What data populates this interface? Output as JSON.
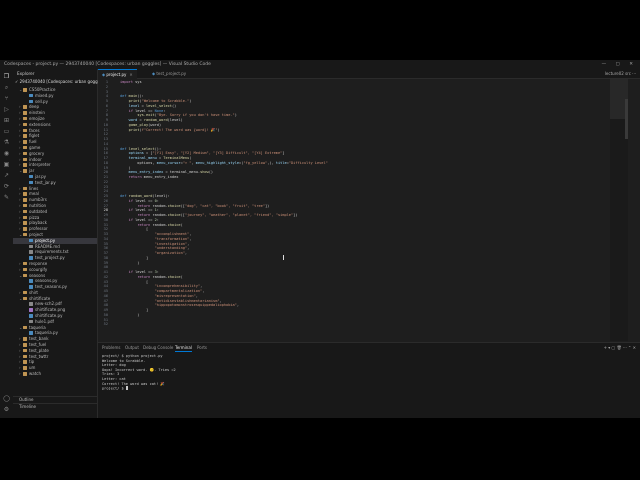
{
  "window": {
    "title": "Codespaces - project.py — 2943740040 [Codespaces: urban goggles] — Visual Studio Code",
    "center_title": "— 2943740040 [Codespaces: urban goggles] — Visual Studio Code",
    "controls": "— ▢ ✕"
  },
  "sidebar": {
    "title": "Explorer",
    "root": "✓ 2943740040 [Codespaces: urban goggles]",
    "items": [
      {
        "label": "CS50Practice",
        "type": "folder",
        "open": true,
        "depth": 1
      },
      {
        "label": "mixed.py",
        "type": "py",
        "depth": 2
      },
      {
        "label": "sell.py",
        "type": "py",
        "depth": 2
      },
      {
        "label": "deep",
        "type": "folder",
        "depth": 1
      },
      {
        "label": "einstein",
        "type": "folder",
        "depth": 1
      },
      {
        "label": "emojize",
        "type": "folder",
        "depth": 1
      },
      {
        "label": "extensions",
        "type": "folder",
        "depth": 1
      },
      {
        "label": "faces",
        "type": "folder",
        "depth": 1
      },
      {
        "label": "figlet",
        "type": "folder",
        "depth": 1
      },
      {
        "label": "fuel",
        "type": "folder",
        "depth": 1
      },
      {
        "label": "game",
        "type": "folder",
        "depth": 1
      },
      {
        "label": "grocery",
        "type": "folder",
        "depth": 1
      },
      {
        "label": "indoor",
        "type": "folder",
        "depth": 1
      },
      {
        "label": "interpreter",
        "type": "folder",
        "depth": 1
      },
      {
        "label": "jar",
        "type": "folder",
        "open": true,
        "depth": 1
      },
      {
        "label": "jar.py",
        "type": "py",
        "depth": 2
      },
      {
        "label": "test_jar.py",
        "type": "py",
        "depth": 2
      },
      {
        "label": "lines",
        "type": "folder",
        "depth": 1
      },
      {
        "label": "meal",
        "type": "folder",
        "depth": 1
      },
      {
        "label": "numb3rs",
        "type": "folder",
        "depth": 1
      },
      {
        "label": "nutrition",
        "type": "folder",
        "depth": 1
      },
      {
        "label": "outdated",
        "type": "folder",
        "depth": 1
      },
      {
        "label": "pizza",
        "type": "folder",
        "depth": 1
      },
      {
        "label": "playback",
        "type": "folder",
        "depth": 1
      },
      {
        "label": "professor",
        "type": "folder",
        "depth": 1
      },
      {
        "label": "project",
        "type": "folder",
        "open": true,
        "depth": 1
      },
      {
        "label": "project.py",
        "type": "py",
        "depth": 2,
        "current": true
      },
      {
        "label": "README.md",
        "type": "txt",
        "depth": 2
      },
      {
        "label": "requirements.txt",
        "type": "txt",
        "depth": 2
      },
      {
        "label": "test_project.py",
        "type": "py",
        "depth": 2
      },
      {
        "label": "response",
        "type": "folder",
        "depth": 1
      },
      {
        "label": "scourgify",
        "type": "folder",
        "depth": 1
      },
      {
        "label": "seasons",
        "type": "folder",
        "open": true,
        "depth": 1
      },
      {
        "label": "seasons.py",
        "type": "py",
        "depth": 2
      },
      {
        "label": "test_seasons.py",
        "type": "py",
        "depth": 2
      },
      {
        "label": "shirt",
        "type": "folder",
        "depth": 1
      },
      {
        "label": "shirtificate",
        "type": "folder",
        "open": true,
        "depth": 1
      },
      {
        "label": "new-sch2.pdf",
        "type": "txt",
        "depth": 2
      },
      {
        "label": "shirtificate.png",
        "type": "img",
        "depth": 2
      },
      {
        "label": "shirtificate.py",
        "type": "py",
        "depth": 2
      },
      {
        "label": "hule1.pdf",
        "type": "txt",
        "depth": 2
      },
      {
        "label": "taqueria",
        "type": "folder",
        "open": true,
        "depth": 1
      },
      {
        "label": "taqueria.py",
        "type": "py",
        "depth": 2
      },
      {
        "label": "test_bank",
        "type": "folder",
        "depth": 1
      },
      {
        "label": "test_fuel",
        "type": "folder",
        "depth": 1
      },
      {
        "label": "test_plate",
        "type": "folder",
        "depth": 1
      },
      {
        "label": "test_twttr",
        "type": "folder",
        "depth": 1
      },
      {
        "label": "tip",
        "type": "folder",
        "depth": 1
      },
      {
        "label": "um",
        "type": "folder",
        "depth": 1
      },
      {
        "label": "watch",
        "type": "folder",
        "depth": 1
      }
    ],
    "outline": "Outline",
    "timeline": "Timeline"
  },
  "tabs": [
    {
      "label": "project.py",
      "active": true
    },
    {
      "label": "test_project.py",
      "active": false
    }
  ],
  "tabs_right": "lecture02  src ···",
  "editor": {
    "lines": [
      [
        [
          "kw",
          "import"
        ],
        [
          "code",
          " sys"
        ]
      ],
      [],
      [],
      [
        [
          "def",
          "def"
        ],
        [
          "code",
          " "
        ],
        [
          "fn",
          "main"
        ],
        [
          "code",
          "():"
        ]
      ],
      [
        [
          "code",
          "    "
        ],
        [
          "fn",
          "print"
        ],
        [
          "code",
          "("
        ],
        [
          "str",
          "\"Welcome to Scrabble.\""
        ],
        [
          "code",
          ")"
        ]
      ],
      [
        [
          "code",
          "    "
        ],
        [
          "var",
          "level"
        ],
        [
          "code",
          " = "
        ],
        [
          "fn",
          "level_select"
        ],
        [
          "code",
          "()"
        ]
      ],
      [
        [
          "code",
          "    "
        ],
        [
          "kw",
          "if"
        ],
        [
          "code",
          " level == "
        ],
        [
          "def",
          "None"
        ],
        [
          "code",
          ":"
        ]
      ],
      [
        [
          "code",
          "        "
        ],
        [
          "fn",
          "sys.exit"
        ],
        [
          "code",
          "("
        ],
        [
          "str",
          "\"Bye. Sorry if you don't have time.\""
        ],
        [
          "code",
          ")"
        ]
      ],
      [
        [
          "code",
          "    "
        ],
        [
          "var",
          "word"
        ],
        [
          "code",
          " = "
        ],
        [
          "fn",
          "random_word"
        ],
        [
          "code",
          "(level)"
        ]
      ],
      [
        [
          "code",
          "    "
        ],
        [
          "fn",
          "game_play"
        ],
        [
          "code",
          "(word)"
        ]
      ],
      [
        [
          "code",
          "    "
        ],
        [
          "fn",
          "print"
        ],
        [
          "code",
          "("
        ],
        [
          "str",
          "f\"Correct! The word was {word}! 🎉\""
        ],
        [
          "code",
          ")"
        ]
      ],
      [],
      [],
      [],
      [
        [
          "def",
          "def"
        ],
        [
          "code",
          " "
        ],
        [
          "fn",
          "level_select"
        ],
        [
          "code",
          "():"
        ]
      ],
      [
        [
          "code",
          "    "
        ],
        [
          "var",
          "options"
        ],
        [
          "code",
          " = ["
        ],
        [
          "str",
          "\"[Y1] Easy\", \"[Y2] Medium\", \"[Y3] Difficult\", \"[Y4] Extreme\""
        ],
        [
          "code",
          "]"
        ]
      ],
      [
        [
          "code",
          "    "
        ],
        [
          "var",
          "terminal_menu"
        ],
        [
          "code",
          " = "
        ],
        [
          "fn",
          "TerminalMenu"
        ],
        [
          "code",
          "("
        ]
      ],
      [
        [
          "code",
          "        options, "
        ],
        [
          "var",
          "menu_cursor"
        ],
        [
          "code",
          "="
        ],
        [
          "str",
          "\"> \""
        ],
        [
          "code",
          ", "
        ],
        [
          "var",
          "menu_highlight_style"
        ],
        [
          "code",
          "=("
        ],
        [
          "str",
          "\"fg_yellow\""
        ],
        [
          "code",
          ",), "
        ],
        [
          "var",
          "title"
        ],
        [
          "code",
          "="
        ],
        [
          "str",
          "\"Difficulty Level\""
        ]
      ],
      [
        [
          "code",
          "    )"
        ]
      ],
      [
        [
          "code",
          "    "
        ],
        [
          "var",
          "menu_entry_index"
        ],
        [
          "code",
          " = terminal_menu."
        ],
        [
          "fn",
          "show"
        ],
        [
          "code",
          "()"
        ]
      ],
      [
        [
          "code",
          "    "
        ],
        [
          "kw",
          "return"
        ],
        [
          "code",
          " menu_entry_index"
        ]
      ],
      [],
      [],
      [],
      [
        [
          "def",
          "def"
        ],
        [
          "code",
          " "
        ],
        [
          "fn",
          "random_word"
        ],
        [
          "code",
          "(level):"
        ]
      ],
      [
        [
          "code",
          "    "
        ],
        [
          "kw",
          "if"
        ],
        [
          "code",
          " level == "
        ],
        [
          "num",
          "0"
        ],
        [
          "code",
          ":"
        ]
      ],
      [
        [
          "code",
          "        "
        ],
        [
          "kw",
          "return"
        ],
        [
          "code",
          " random."
        ],
        [
          "fn",
          "choice"
        ],
        [
          "code",
          "(["
        ],
        [
          "str",
          "\"dog\", \"cat\", \"book\", \"fruit\", \"tree\""
        ],
        [
          "code",
          "])"
        ]
      ],
      [
        [
          "code",
          "    "
        ],
        [
          "kw",
          "if"
        ],
        [
          "code",
          " level == "
        ],
        [
          "num",
          "1"
        ],
        [
          "code",
          ":"
        ]
      ],
      [
        [
          "code",
          "        "
        ],
        [
          "kw",
          "return"
        ],
        [
          "code",
          " random."
        ],
        [
          "fn",
          "choice"
        ],
        [
          "code",
          "(["
        ],
        [
          "str",
          "\"journey\", \"weather\", \"planet\", \"friend\", \"simple\""
        ],
        [
          "code",
          "])"
        ]
      ],
      [
        [
          "code",
          "    "
        ],
        [
          "kw",
          "if"
        ],
        [
          "code",
          " level == "
        ],
        [
          "num",
          "2"
        ],
        [
          "code",
          ":"
        ]
      ],
      [
        [
          "code",
          "        "
        ],
        [
          "kw",
          "return"
        ],
        [
          "code",
          " random."
        ],
        [
          "fn",
          "choice"
        ],
        [
          "code",
          "("
        ]
      ],
      [
        [
          "code",
          "            ["
        ]
      ],
      [
        [
          "code",
          "                "
        ],
        [
          "str",
          "\"accomplishment\""
        ],
        [
          "code",
          ","
        ]
      ],
      [
        [
          "code",
          "                "
        ],
        [
          "str",
          "\"transformation\""
        ],
        [
          "code",
          ","
        ]
      ],
      [
        [
          "code",
          "                "
        ],
        [
          "str",
          "\"investigation\""
        ],
        [
          "code",
          ","
        ]
      ],
      [
        [
          "code",
          "                "
        ],
        [
          "str",
          "\"understanding\""
        ],
        [
          "code",
          ","
        ]
      ],
      [
        [
          "code",
          "                "
        ],
        [
          "str",
          "\"organization\""
        ],
        [
          "code",
          ","
        ]
      ],
      [
        [
          "code",
          "            ]"
        ]
      ],
      [
        [
          "code",
          "        )"
        ]
      ],
      [],
      [
        [
          "code",
          "    "
        ],
        [
          "kw",
          "if"
        ],
        [
          "code",
          " level == "
        ],
        [
          "num",
          "3"
        ],
        [
          "code",
          ":"
        ]
      ],
      [
        [
          "code",
          "        "
        ],
        [
          "kw",
          "return"
        ],
        [
          "code",
          " random."
        ],
        [
          "fn",
          "choice"
        ],
        [
          "code",
          "("
        ]
      ],
      [
        [
          "code",
          "            ["
        ]
      ],
      [
        [
          "code",
          "                "
        ],
        [
          "str",
          "\"incomprehensibility\""
        ],
        [
          "code",
          ","
        ]
      ],
      [
        [
          "code",
          "                "
        ],
        [
          "str",
          "\"compartmentalization\""
        ],
        [
          "code",
          ","
        ]
      ],
      [
        [
          "code",
          "                "
        ],
        [
          "str",
          "\"misrepresentation\""
        ],
        [
          "code",
          ","
        ]
      ],
      [
        [
          "code",
          "                "
        ],
        [
          "str",
          "\"antidisestablishmentarianism\""
        ],
        [
          "code",
          ","
        ]
      ],
      [
        [
          "code",
          "                "
        ],
        [
          "str",
          "\"hippopotomonstrosesquippedaliophobia\""
        ],
        [
          "code",
          ","
        ]
      ],
      [
        [
          "code",
          "            ]"
        ]
      ],
      [
        [
          "code",
          "        )"
        ]
      ],
      [],
      []
    ],
    "current_line": 28
  },
  "panel": {
    "tabs": [
      "Problems",
      "Output",
      "Debug Console",
      "Terminal",
      "Ports"
    ],
    "active_tab": "Terminal",
    "right": "+ ▾ ▢ 🗑 ··· ⌃ ✕",
    "terminal_lines": [
      "project/ $ python project.py",
      "Welcome to Scrabble.",
      "",
      "Letter: dog",
      "Oops! Incorrect word. 🙁. Tries =2",
      "Tries: 3",
      "",
      "Letter: cat",
      "Correct! The word was cat! 🎉",
      "project/ $ "
    ]
  },
  "colors": {
    "accent": "#0078d4",
    "editor_bg": "#1e1e1e",
    "sidebar_bg": "#181818"
  }
}
